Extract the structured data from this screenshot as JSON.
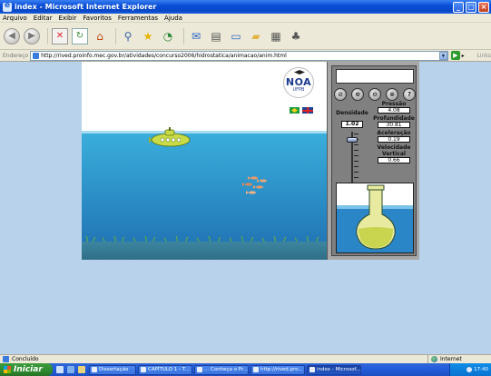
{
  "window": {
    "title": "index - Microsoft Internet Explorer",
    "minimize": "_",
    "maximize": "□",
    "close": "×"
  },
  "menu": [
    "Arquivo",
    "Editar",
    "Exibir",
    "Favoritos",
    "Ferramentas",
    "Ajuda"
  ],
  "address": {
    "label": "Endereço",
    "url": "http://rived.proinfo.mec.gov.br/atividades/concurso2006/hidrostatica/animacao/anim.html",
    "go_arrow": "▶",
    "links": "Links"
  },
  "app": {
    "logo_text": "NOA",
    "logo_subtext": "UFPB",
    "controls": [
      "⊘",
      "⊕",
      "⊖",
      "⊗",
      "?"
    ],
    "density_label": "Densidade",
    "density_value": "1.02",
    "slider_level": 0.85,
    "pressure_label": "Pressão",
    "pressure_value": "4.08",
    "depth_label": "Profundidade",
    "depth_value": "30.81",
    "acceleration_label": "Aceleração",
    "acceleration_value": "0.19",
    "velocity_label_1": "Velocidade",
    "velocity_label_2": "Vertical",
    "velocity_value": "0.66"
  },
  "status": {
    "text": "Concluído",
    "zone": "Internet"
  },
  "taskbar": {
    "start": "Iniciar",
    "tasks": [
      "Dissertação",
      "CAPÍTULO 1 - T...",
      "... Conheça o Pr...",
      "http://rived.pro...",
      "index - Microsof..."
    ],
    "clock": "17:40"
  },
  "colors": {
    "titlebar": "#0a4fd8",
    "water": "#2f97cc",
    "panel": "#808080",
    "submarine": "#c9dc46"
  }
}
